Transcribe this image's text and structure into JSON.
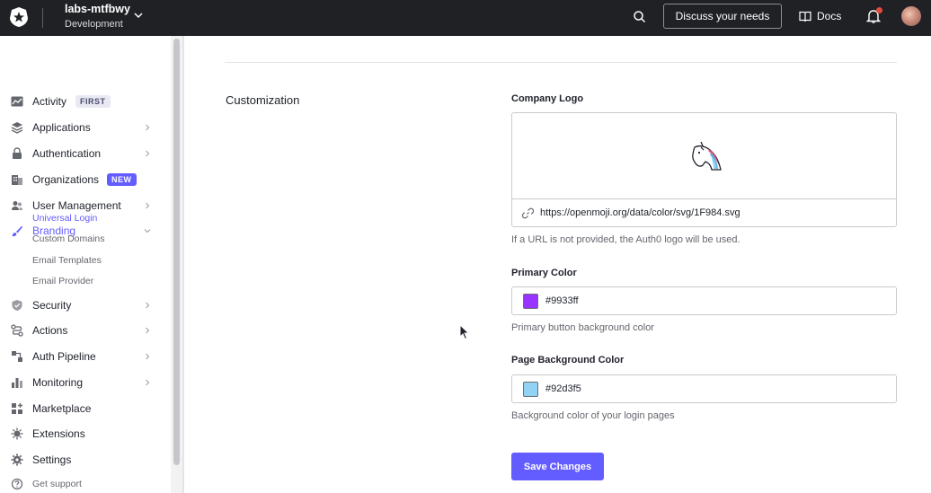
{
  "topbar": {
    "tenant_name": "labs-mtfbwy",
    "tenant_env": "Development",
    "discuss_label": "Discuss your needs",
    "docs_label": "Docs",
    "has_notification": true
  },
  "sidebar": {
    "items": [
      {
        "label": "Activity",
        "icon": "activity-icon",
        "badge": "FIRST"
      },
      {
        "label": "Applications",
        "icon": "applications-icon"
      },
      {
        "label": "Authentication",
        "icon": "lock-icon"
      },
      {
        "label": "Organizations",
        "icon": "building-icon",
        "badge": "NEW"
      },
      {
        "label": "User Management",
        "icon": "users-icon"
      },
      {
        "label": "Branding",
        "icon": "brush-icon",
        "expanded": true
      },
      {
        "label": "Security",
        "icon": "shield-icon"
      },
      {
        "label": "Actions",
        "icon": "actions-icon"
      },
      {
        "label": "Auth Pipeline",
        "icon": "pipeline-icon"
      },
      {
        "label": "Monitoring",
        "icon": "chart-icon"
      },
      {
        "label": "Marketplace",
        "icon": "marketplace-icon"
      },
      {
        "label": "Extensions",
        "icon": "extensions-icon"
      },
      {
        "label": "Settings",
        "icon": "gear-icon"
      }
    ],
    "branding_sub": [
      {
        "label": "Universal Login",
        "active": true
      },
      {
        "label": "Custom Domains"
      },
      {
        "label": "Email Templates"
      },
      {
        "label": "Email Provider"
      }
    ],
    "support_label": "Get support"
  },
  "main": {
    "section_title": "Customization",
    "company_logo": {
      "label": "Company Logo",
      "url": "https://openmoji.org/data/color/svg/1F984.svg",
      "helper": "If a URL is not provided, the Auth0 logo will be used."
    },
    "primary_color": {
      "label": "Primary Color",
      "value": "#9933ff",
      "helper": "Primary button background color"
    },
    "page_background_color": {
      "label": "Page Background Color",
      "value": "#92d3f5",
      "helper": "Background color of your login pages"
    },
    "save_label": "Save Changes"
  },
  "colors": {
    "accent": "#635dff",
    "topbar": "#1f2125"
  }
}
